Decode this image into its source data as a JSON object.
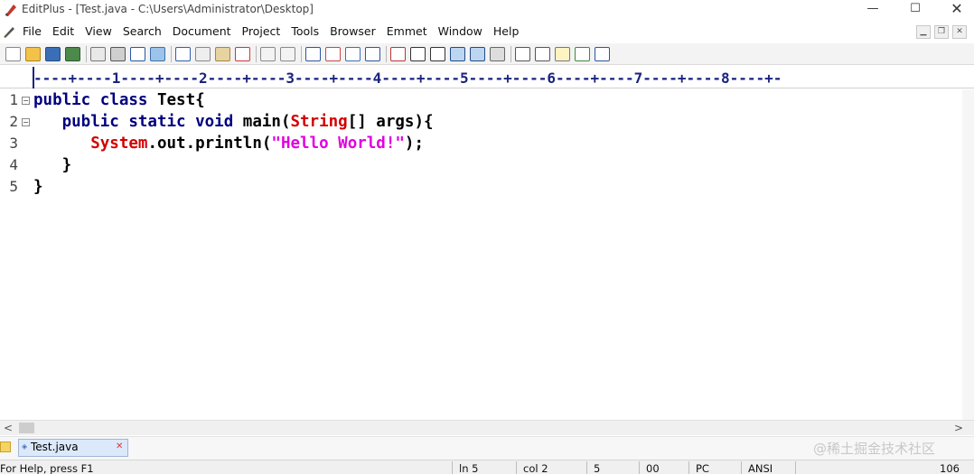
{
  "window": {
    "title": "EditPlus - [Test.java - C:\\Users\\Administrator\\Desktop]",
    "min_glyph": "—",
    "max_glyph": "☐",
    "close_glyph": "✕"
  },
  "menu": {
    "items": [
      "File",
      "Edit",
      "View",
      "Search",
      "Document",
      "Project",
      "Tools",
      "Browser",
      "Emmet",
      "Window",
      "Help"
    ],
    "mdi_min": "▁",
    "mdi_restore": "❐",
    "mdi_close": "✕"
  },
  "toolbar": {
    "buttons": [
      "new-file-icon",
      "open-folder-icon",
      "save-icon",
      "save-all-icon",
      "print-preview-icon",
      "print-icon",
      "spell-check-icon",
      "html-preview-icon",
      "cut-icon",
      "copy-icon",
      "paste-icon",
      "delete-icon",
      "undo-icon",
      "redo-icon",
      "find-icon",
      "replace-icon",
      "find-in-files-icon",
      "indent-icon",
      "font-icon",
      "hex-icon",
      "word-wrap-icon",
      "line-wrap-icon",
      "column-select-icon",
      "settings-icon",
      "browser-icon",
      "document-icon",
      "clip-text-icon",
      "output-window-icon",
      "help-icon"
    ]
  },
  "ruler": {
    "text": "----+----1----+----2----+----3----+----4----+----5----+----6----+----7----+----8----+-"
  },
  "editor": {
    "lines": [
      {
        "num": "1",
        "fold": "−"
      },
      {
        "num": "2",
        "fold": "−"
      },
      {
        "num": "3",
        "fold": ""
      },
      {
        "num": "4",
        "fold": ""
      },
      {
        "num": "5",
        "fold": ""
      }
    ],
    "code": {
      "l1_kw": "public class ",
      "l1_txt": "Test{",
      "l2_indent": "   ",
      "l2_kw": "public static void ",
      "l2_txt1": "main(",
      "l2_cls": "String",
      "l2_txt2": "[] args){",
      "l3_indent": "      ",
      "l3_cls": "System",
      "l3_txt1": ".out.println(",
      "l3_str": "\"Hello World!\"",
      "l3_txt2": ");",
      "l4": "   }",
      "l5": "}"
    }
  },
  "scroll": {
    "left_arrow": "<",
    "right_arrow": ">"
  },
  "tabs": {
    "file_tab_label": "Test.java",
    "file_tab_icon": "◈",
    "close_glyph": "✕"
  },
  "status": {
    "help": "For Help, press F1",
    "line": "ln 5",
    "col": "col 2",
    "lines_total": "5",
    "hex": "00",
    "eol": "PC",
    "encoding": "ANSI",
    "size": "106"
  },
  "watermark": "@稀土掘金技术社区",
  "colors": {
    "keyword": "#000080",
    "class": "#d40000",
    "string": "#e000e0",
    "ruler": "#1a237e"
  }
}
